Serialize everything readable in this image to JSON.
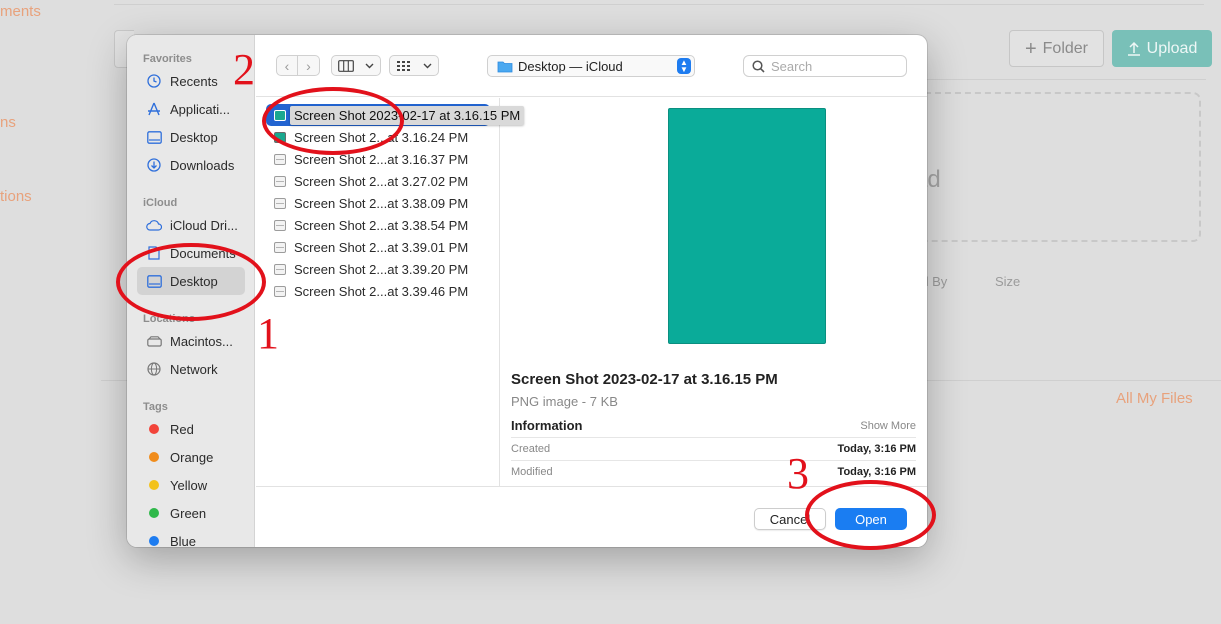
{
  "background": {
    "left_labels": [
      "ments",
      "ns",
      "tions"
    ],
    "folder_button": "Folder",
    "upload_button": "Upload",
    "drop_text": "ad",
    "col_modified_by": "ed By",
    "col_size": "Size",
    "all_my_files": "All My Files"
  },
  "dialog": {
    "sidebar": {
      "favorites_header": "Favorites",
      "favorites": [
        {
          "label": "Recents",
          "icon": "clock-icon"
        },
        {
          "label": "Applicati...",
          "icon": "apps-icon"
        },
        {
          "label": "Desktop",
          "icon": "desktop-icon"
        },
        {
          "label": "Downloads",
          "icon": "download-icon"
        }
      ],
      "icloud_header": "iCloud",
      "icloud": [
        {
          "label": "iCloud Dri...",
          "icon": "cloud-icon"
        },
        {
          "label": "Documents",
          "icon": "document-icon"
        },
        {
          "label": "Desktop",
          "icon": "desktop-icon",
          "selected": true
        }
      ],
      "locations_header": "Locations",
      "locations": [
        {
          "label": "Macintos...",
          "icon": "harddrive-icon"
        },
        {
          "label": "Network",
          "icon": "globe-icon"
        }
      ],
      "tags_header": "Tags",
      "tags": [
        {
          "label": "Red",
          "color": "#f2443a"
        },
        {
          "label": "Orange",
          "color": "#f08c1c"
        },
        {
          "label": "Yellow",
          "color": "#f3c21b"
        },
        {
          "label": "Green",
          "color": "#2fb84a"
        },
        {
          "label": "Blue",
          "color": "#1d7cf0"
        }
      ]
    },
    "toolbar": {
      "location": "Desktop — iCloud",
      "search_placeholder": "Search"
    },
    "files": [
      {
        "name": "Screen Shot 2023-02-17 at 3.16.15 PM",
        "selected": true
      },
      {
        "name": "Screen Shot 2...at 3.16.24 PM"
      },
      {
        "name": "Screen Shot 2...at 3.16.37 PM"
      },
      {
        "name": "Screen Shot 2...at 3.27.02 PM"
      },
      {
        "name": "Screen Shot 2...at 3.38.09 PM"
      },
      {
        "name": "Screen Shot 2...at 3.38.54 PM"
      },
      {
        "name": "Screen Shot 2...at 3.39.01 PM"
      },
      {
        "name": "Screen Shot 2...at 3.39.20 PM"
      },
      {
        "name": "Screen Shot 2...at 3.39.46 PM"
      }
    ],
    "preview": {
      "name": "Screen Shot 2023-02-17 at 3.16.15 PM",
      "kind": "PNG image - 7 KB",
      "info_header": "Information",
      "show_more": "Show More",
      "created_label": "Created",
      "created_value": "Today, 3:16 PM",
      "modified_label": "Modified",
      "modified_value": "Today, 3:16 PM",
      "thumb_color": "#0aab99"
    },
    "buttons": {
      "cancel": "Cancel",
      "open": "Open"
    }
  },
  "annotations": {
    "color": "#e2111b",
    "step1": "1",
    "step2": "2",
    "step3": "3"
  }
}
